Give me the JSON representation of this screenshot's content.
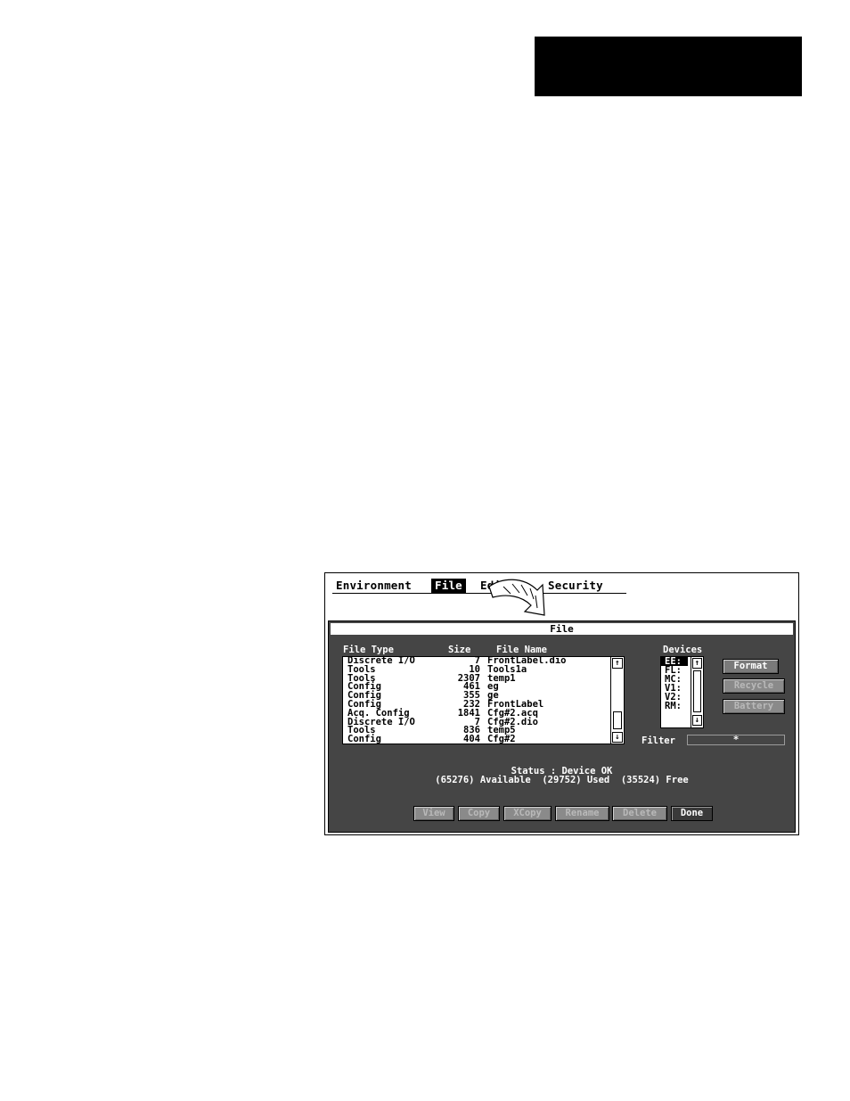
{
  "menu": {
    "items": [
      "Environment",
      "File",
      "Editors",
      "Security"
    ],
    "active": "File"
  },
  "dialog": {
    "title": "File",
    "headers": {
      "type": "File Type",
      "size": "Size",
      "name": "File Name",
      "devices": "Devices"
    },
    "files": [
      {
        "type": "Discrete I/O",
        "size": "7",
        "name": "FrontLabel.dio"
      },
      {
        "type": "Tools",
        "size": "10",
        "name": "Tools1a"
      },
      {
        "type": "Tools",
        "size": "2307",
        "name": "temp1"
      },
      {
        "type": "Config",
        "size": "461",
        "name": "eg"
      },
      {
        "type": "Config",
        "size": "355",
        "name": "ge"
      },
      {
        "type": "Config",
        "size": "232",
        "name": "FrontLabel"
      },
      {
        "type": "Acq. Config",
        "size": "1841",
        "name": "Cfg#2.acq"
      },
      {
        "type": "Discrete I/O",
        "size": "7",
        "name": "Cfg#2.dio"
      },
      {
        "type": "Tools",
        "size": "836",
        "name": "temp5"
      },
      {
        "type": "Config",
        "size": "404",
        "name": "Cfg#2"
      }
    ],
    "devices": [
      "EE:",
      "FL:",
      "MC:",
      "V1:",
      "V2:",
      "RM:"
    ],
    "selected_device": "EE:",
    "side_buttons": {
      "format": "Format",
      "recycle": "Recycle",
      "battery": "Battery"
    },
    "filter": {
      "label": "Filter",
      "value": "*"
    },
    "status": {
      "line1": "Status : Device OK",
      "line2": "(65276) Available  (29752) Used  (35524) Free"
    },
    "buttons": {
      "view": "View",
      "copy": "Copy",
      "xcopy": "XCopy",
      "rename": "Rename",
      "delete": "Delete",
      "done": "Done"
    }
  },
  "colors": {
    "dialog_bg": "#454545",
    "header_block": "#000000"
  }
}
